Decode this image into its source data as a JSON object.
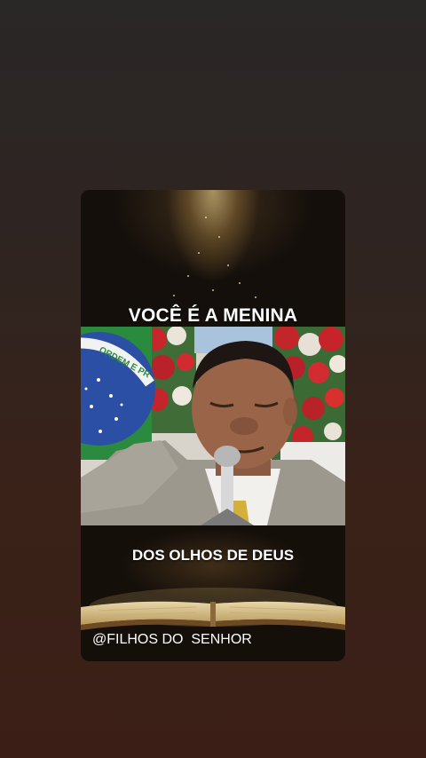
{
  "story": {
    "caption_top": "VOCÊ É A MENINA",
    "caption_bottom": "DOS OLHOS DE DEUS",
    "watermark": "@FILHOS DO  SENHOR",
    "flag_motto": "ORDEM E PR"
  },
  "colors": {
    "background_top": "#2a2727",
    "background_bottom": "#3b1f17",
    "card_background": "#120d09",
    "caption_text": "#ffffff",
    "flag_blue": "#2c4fa6",
    "flag_green": "#2a8a3e",
    "suit_gray": "#9e9a90",
    "tie_gold": "#d4b03a"
  }
}
